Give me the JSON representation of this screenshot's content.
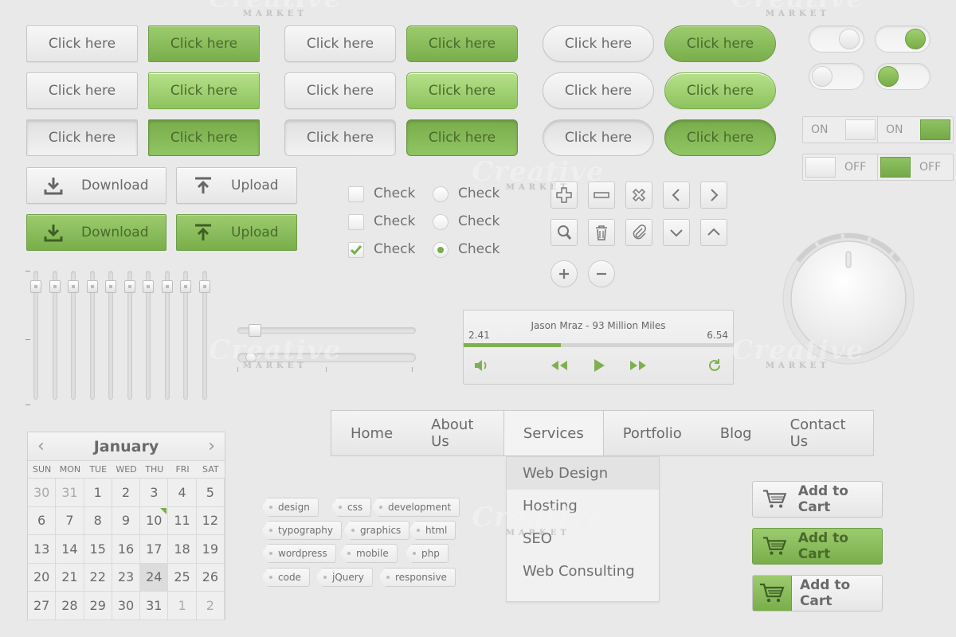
{
  "buttons": {
    "label": "Click here",
    "download": "Download",
    "upload": "Upload"
  },
  "toggles": {
    "on": "ON",
    "off": "OFF"
  },
  "checks": {
    "label": "Check",
    "states": [
      false,
      false,
      true
    ],
    "radio_selected_index": 2
  },
  "sliders": {
    "vertical_levels": [
      0.9,
      0.9,
      0.9,
      0.9,
      0.9,
      0.9,
      0.9,
      0.9,
      0.9,
      0.9
    ],
    "horizontal_levels": [
      0.1,
      0.08
    ]
  },
  "player": {
    "artist": "Jason Mraz",
    "separator": "-",
    "track": "93 Million Miles",
    "elapsed": "2.41",
    "total": "6.54",
    "progress": 0.36
  },
  "nav": {
    "items": [
      "Home",
      "About Us",
      "Services",
      "Portfolio",
      "Blog",
      "Contact Us"
    ],
    "active_index": 2,
    "submenu": [
      "Web Design",
      "Hosting",
      "SEO",
      "Web Consulting"
    ]
  },
  "calendar": {
    "month": "January",
    "prev": "‹",
    "next": "›",
    "weekdays": [
      "SUN",
      "MON",
      "TUE",
      "WED",
      "THU",
      "FRI",
      "SAT"
    ],
    "days": [
      "30",
      "31",
      "1",
      "2",
      "3",
      "4",
      "5",
      "6",
      "7",
      "8",
      "9",
      "10",
      "11",
      "12",
      "13",
      "14",
      "15",
      "16",
      "17",
      "18",
      "19",
      "20",
      "21",
      "22",
      "23",
      "24",
      "25",
      "26",
      "27",
      "28",
      "29",
      "30",
      "31",
      "1",
      "2"
    ],
    "other_month_indices": [
      0,
      1,
      33,
      34
    ],
    "today_index": 25,
    "marked_index": 11
  },
  "tags": [
    "design",
    "css",
    "development",
    "typography",
    "graphics",
    "html",
    "wordpress",
    "mobile",
    "php",
    "code",
    "jQuery",
    "responsive"
  ],
  "cart": {
    "label": "Add to Cart"
  },
  "watermark": {
    "word": "Creative",
    "sub": "MARKET"
  },
  "colors": {
    "accent": "#7fb04f",
    "background": "#e9e9e9"
  }
}
